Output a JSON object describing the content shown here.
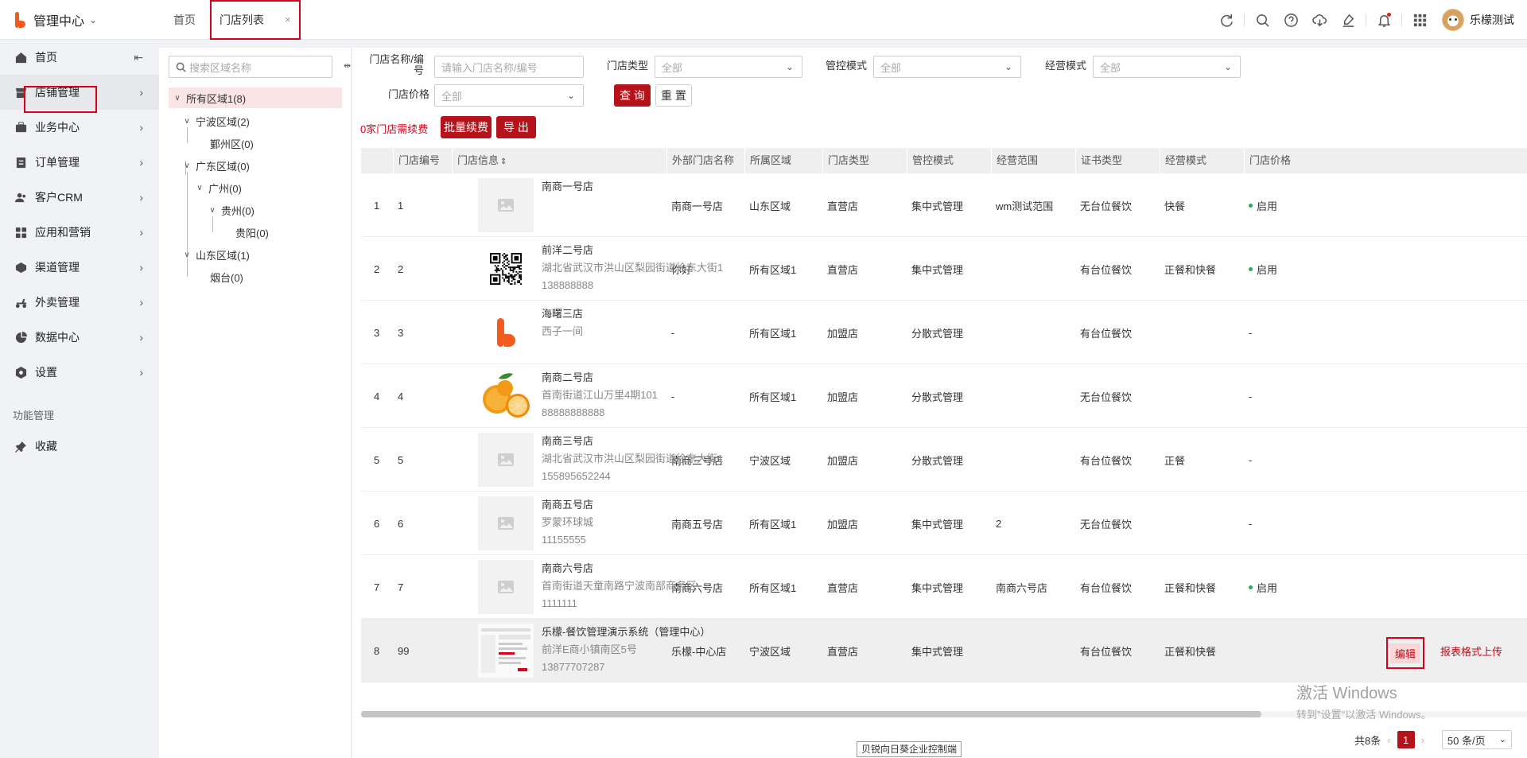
{
  "app": {
    "title": "管理中心"
  },
  "tabs": [
    {
      "label": "首页"
    },
    {
      "label": "门店列表",
      "close": "×"
    }
  ],
  "user": {
    "name": "乐檬测试"
  },
  "sidebar": {
    "items": [
      {
        "label": "首页",
        "icon": "home-icon"
      },
      {
        "label": "店铺管理",
        "icon": "store-icon"
      },
      {
        "label": "业务中心",
        "icon": "briefcase-icon"
      },
      {
        "label": "订单管理",
        "icon": "order-icon"
      },
      {
        "label": "客户CRM",
        "icon": "customer-icon"
      },
      {
        "label": "应用和营销",
        "icon": "apps-icon"
      },
      {
        "label": "渠道管理",
        "icon": "channel-icon"
      },
      {
        "label": "外卖管理",
        "icon": "delivery-icon"
      },
      {
        "label": "数据中心",
        "icon": "chart-icon"
      },
      {
        "label": "设置",
        "icon": "settings-icon"
      }
    ],
    "section_label": "功能管理",
    "favorite_label": "收藏"
  },
  "tree": {
    "search_placeholder": "搜索区域名称",
    "nodes": [
      {
        "label": "所有区域1(8)"
      },
      {
        "label": "宁波区域(2)"
      },
      {
        "label": "鄞州区(0)"
      },
      {
        "label": "广东区域(0)"
      },
      {
        "label": "广州(0)"
      },
      {
        "label": "贵州(0)"
      },
      {
        "label": "贵阳(0)"
      },
      {
        "label": "山东区域(1)"
      },
      {
        "label": "烟台(0)"
      }
    ]
  },
  "filters": {
    "name_label": "门店名称/编号",
    "name_placeholder": "请输入门店名称/编号",
    "type_label": "门店类型",
    "type_value": "全部",
    "control_label": "管控模式",
    "control_value": "全部",
    "business_label": "经营模式",
    "business_value": "全部",
    "price_label": "门店价格",
    "price_value": "全部",
    "query_button": "查 询",
    "reset_button": "重 置"
  },
  "actions": {
    "notice": "0家门店需续费",
    "renew_button": "批量续费",
    "export_button": "导 出"
  },
  "table": {
    "columns": [
      "门店编号",
      "门店信息",
      "外部门店名称",
      "所属区域",
      "门店类型",
      "管控模式",
      "经营范围",
      "证书类型",
      "经营模式",
      "门店价格"
    ],
    "rows": [
      {
        "idx": "1",
        "code": "1",
        "name": "南商一号店",
        "addr": "",
        "phone": "",
        "ext": "南商一号店",
        "region": "山东区域",
        "type": "直营店",
        "control": "集中式管理",
        "scope": "wm测试范围",
        "cert": "无台位餐饮",
        "mode": "快餐",
        "price": "启用",
        "thumb": "placeholder"
      },
      {
        "idx": "2",
        "code": "2",
        "name": "前洋二号店",
        "addr": "湖北省武汉市洪山区梨园街道徐东大街1",
        "phone": "138888888",
        "ext": "你好",
        "region": "所有区域1",
        "type": "直营店",
        "control": "集中式管理",
        "scope": "",
        "cert": "有台位餐饮",
        "mode": "正餐和快餐",
        "price": "启用",
        "thumb": "qr"
      },
      {
        "idx": "3",
        "code": "3",
        "name": "海曙三店",
        "addr": "西子一间",
        "phone": "",
        "ext": "-",
        "region": "所有区域1",
        "type": "加盟店",
        "control": "分散式管理",
        "scope": "",
        "cert": "有台位餐饮",
        "mode": "",
        "price": "-",
        "thumb": "logo"
      },
      {
        "idx": "4",
        "code": "4",
        "name": "南商二号店",
        "addr": "首南街道江山万里4期101",
        "phone": "88888888888",
        "ext": "-",
        "region": "所有区域1",
        "type": "加盟店",
        "control": "分散式管理",
        "scope": "",
        "cert": "无台位餐饮",
        "mode": "",
        "price": "-",
        "thumb": "orange"
      },
      {
        "idx": "5",
        "code": "5",
        "name": "南商三号店",
        "addr": "湖北省武汉市洪山区梨园街道徐东大街1",
        "phone": "155895652244",
        "ext": "南商三号店",
        "region": "宁波区域",
        "type": "加盟店",
        "control": "分散式管理",
        "scope": "",
        "cert": "有台位餐饮",
        "mode": "正餐",
        "price": "-",
        "thumb": "placeholder"
      },
      {
        "idx": "6",
        "code": "6",
        "name": "南商五号店",
        "addr": "罗蒙环球城",
        "phone": "11155555",
        "ext": "南商五号店",
        "region": "所有区域1",
        "type": "加盟店",
        "control": "集中式管理",
        "scope": "2",
        "cert": "无台位餐饮",
        "mode": "",
        "price": "-",
        "thumb": "placeholder"
      },
      {
        "idx": "7",
        "code": "7",
        "name": "南商六号店",
        "addr": "首南街道天童南路宁波南部商务区",
        "phone": "1111111",
        "ext": "南商六号店",
        "region": "所有区域1",
        "type": "直营店",
        "control": "集中式管理",
        "scope": "南商六号店",
        "cert": "有台位餐饮",
        "mode": "正餐和快餐",
        "price": "启用",
        "thumb": "placeholder"
      },
      {
        "idx": "8",
        "code": "99",
        "name": "乐檬-餐饮管理演示系统（管理中心）",
        "addr": "前洋E商小镇南区5号",
        "phone": "13877707287",
        "ext": "乐檬-中心店",
        "region": "宁波区域",
        "type": "直营店",
        "control": "集中式管理",
        "scope": "",
        "cert": "有台位餐饮",
        "mode": "正餐和快餐",
        "price": "",
        "thumb": "screenshot"
      }
    ],
    "edit_button": "编辑",
    "upload_link": "报表格式上传"
  },
  "pagination": {
    "total": "共8条",
    "current": "1",
    "page_size": "50 条/页"
  },
  "footer_tag": "贝锐向日葵企业控制端",
  "watermark": {
    "line1": "激活 Windows",
    "line2": "转到\"设置\"以激活 Windows。"
  }
}
